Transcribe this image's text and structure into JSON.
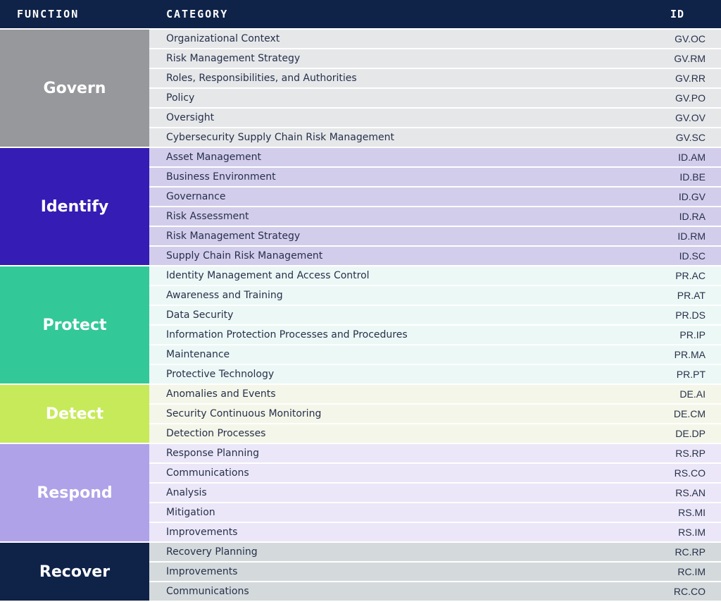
{
  "header": {
    "function_label": "FUNCTION",
    "category_label": "CATEGORY",
    "id_label": "ID"
  },
  "colors": {
    "header_bg": "#0f2248",
    "govern": "#97989c",
    "govern_rows": "#e6e7e9",
    "identify": "#351cb4",
    "identify_rows": "#d3cdec",
    "protect": "#33c898",
    "protect_rows": "#ecf8f6",
    "detect": "#c7ea5a",
    "detect_rows": "#f4f6e9",
    "respond": "#afa2e8",
    "respond_rows": "#ebe7f8",
    "recover": "#0f2248",
    "recover_rows": "#d4dadc"
  },
  "groups": [
    {
      "key": "govern",
      "function": "Govern",
      "rows": [
        {
          "category": "Organizational Context",
          "id": "GV.OC"
        },
        {
          "category": "Risk Management Strategy",
          "id": "GV.RM"
        },
        {
          "category": "Roles, Responsibilities, and Authorities",
          "id": "GV.RR"
        },
        {
          "category": "Policy",
          "id": "GV.PO"
        },
        {
          "category": "Oversight",
          "id": "GV.OV"
        },
        {
          "category": "Cybersecurity Supply Chain Risk Management",
          "id": "GV.SC"
        }
      ]
    },
    {
      "key": "identify",
      "function": "Identify",
      "rows": [
        {
          "category": "Asset Management",
          "id": "ID.AM"
        },
        {
          "category": "Business Environment",
          "id": "ID.BE"
        },
        {
          "category": "Governance",
          "id": "ID.GV"
        },
        {
          "category": "Risk Assessment",
          "id": "ID.RA"
        },
        {
          "category": "Risk Management Strategy",
          "id": "ID.RM"
        },
        {
          "category": "Supply Chain Risk Management",
          "id": "ID.SC"
        }
      ]
    },
    {
      "key": "protect",
      "function": "Protect",
      "rows": [
        {
          "category": "Identity Management and Access Control",
          "id": "PR.AC"
        },
        {
          "category": "Awareness and Training",
          "id": "PR.AT"
        },
        {
          "category": "Data Security",
          "id": "PR.DS"
        },
        {
          "category": "Information Protection Processes and Procedures",
          "id": "PR.IP"
        },
        {
          "category": "Maintenance",
          "id": "PR.MA"
        },
        {
          "category": "Protective Technology",
          "id": "PR.PT"
        }
      ]
    },
    {
      "key": "detect",
      "function": "Detect",
      "rows": [
        {
          "category": "Anomalies and Events",
          "id": "DE.AI"
        },
        {
          "category": "Security Continuous Monitoring",
          "id": "DE.CM"
        },
        {
          "category": "Detection Processes",
          "id": "DE.DP"
        }
      ]
    },
    {
      "key": "respond",
      "function": "Respond",
      "rows": [
        {
          "category": "Response Planning",
          "id": "RS.RP"
        },
        {
          "category": "Communications",
          "id": "RS.CO"
        },
        {
          "category": "Analysis",
          "id": "RS.AN"
        },
        {
          "category": "Mitigation",
          "id": "RS.MI"
        },
        {
          "category": "Improvements",
          "id": "RS.IM"
        }
      ]
    },
    {
      "key": "recover",
      "function": "Recover",
      "rows": [
        {
          "category": "Recovery Planning",
          "id": "RC.RP"
        },
        {
          "category": "Improvements",
          "id": "RC.IM"
        },
        {
          "category": "Communications",
          "id": "RC.CO"
        }
      ]
    }
  ]
}
